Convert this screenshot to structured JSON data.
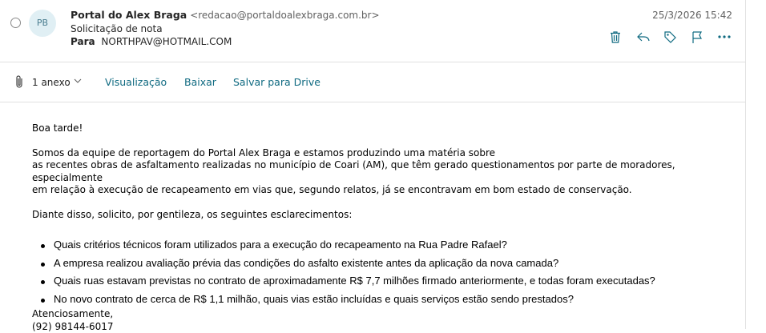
{
  "header": {
    "avatar_initials": "PB",
    "sender_name": "Portal do Alex Braga",
    "sender_email": "<redacao@portaldoalexbraga.com.br>",
    "subject": "Solicitação de nota",
    "to_label": "Para",
    "to_address": "NORTHPAV@HOTMAIL.COM",
    "date": "25/3/2026 15:42",
    "actions": [
      "trash-icon",
      "reply-icon",
      "tag-icon",
      "flag-icon",
      "more-icon"
    ]
  },
  "attachments": {
    "count_label": "1 anexo",
    "preview_label": "Visualização",
    "download_label": "Baixar",
    "save_drive_label": "Salvar para Drive"
  },
  "body": {
    "greeting": "Boa tarde!",
    "intro_line1": "Somos da equipe de reportagem do Portal Alex Braga e estamos produzindo uma matéria sobre",
    "intro_line2": "as recentes obras de asfaltamento realizadas no município de Coari (AM), que têm gerado questionamentos por parte de moradores, especialmente",
    "intro_line3": "em relação à execução de recapeamento em vias que, segundo relatos, já se encontravam em bom estado de conservação.",
    "request": "Diante disso, solicito, por gentileza, os seguintes esclarecimentos:",
    "questions": [
      "Quais critérios técnicos foram utilizados para a execução do recapeamento na Rua Padre Rafael?",
      "A empresa realizou avaliação prévia das condições do asfalto existente antes da aplicação da nova camada?",
      "Quais ruas estavam previstas no contrato de aproximadamente R$ 7,7 milhões firmado anteriormente, e todas foram executadas?",
      "No novo contrato de cerca de R$ 1,1 milhão, quais vias estão incluídas e quais serviços estão sendo prestados?"
    ],
    "closing": "Atenciosamente,",
    "phone": "(92) 98144-6017"
  },
  "colors": {
    "accent": "#0f6a81",
    "avatar_bg": "#e0eff4",
    "divider": "#e1e1e1"
  }
}
